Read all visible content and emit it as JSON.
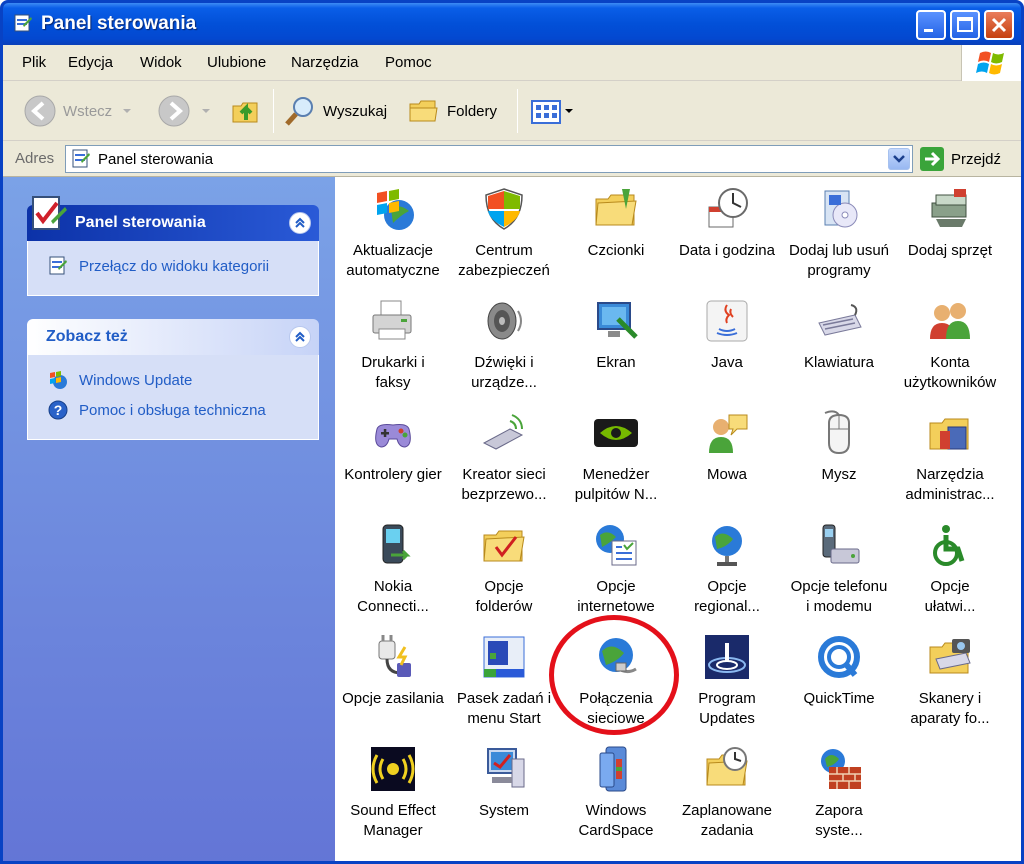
{
  "window": {
    "title": "Panel sterowania"
  },
  "menubar": {
    "items": [
      "Plik",
      "Edycja",
      "Widok",
      "Ulubione",
      "Narzędzia",
      "Pomoc"
    ]
  },
  "toolbar": {
    "back_label": "Wstecz",
    "search_label": "Wyszukaj",
    "folders_label": "Foldery"
  },
  "addressbar": {
    "label": "Adres",
    "value": "Panel sterowania",
    "go_label": "Przejdź"
  },
  "sidebar": {
    "panel_title": "Panel sterowania",
    "panel_link": "Przełącz do widoku kategorii",
    "see_also_title": "Zobacz też",
    "see_also_links": [
      "Windows Update",
      "Pomoc i obsługa techniczna"
    ]
  },
  "items": [
    {
      "label": "Aktualizacje\nautomatyczne",
      "icon": "windows-update-icon"
    },
    {
      "label": "Centrum\nzabezpieczeń",
      "icon": "security-shield-icon"
    },
    {
      "label": "Czcionki",
      "icon": "fonts-folder-icon"
    },
    {
      "label": "Data i godzina",
      "icon": "date-time-icon"
    },
    {
      "label": "Dodaj lub usuń\nprogramy",
      "icon": "add-remove-programs-icon"
    },
    {
      "label": "Dodaj sprzęt",
      "icon": "add-hardware-icon"
    },
    {
      "label": "Drukarki i\nfaksy",
      "icon": "printer-icon"
    },
    {
      "label": "Dźwięki i\nurządze...",
      "icon": "speaker-icon"
    },
    {
      "label": "Ekran",
      "icon": "display-icon"
    },
    {
      "label": "Java",
      "icon": "java-icon"
    },
    {
      "label": "Klawiatura",
      "icon": "keyboard-icon"
    },
    {
      "label": "Konta\nużytkowników",
      "icon": "user-accounts-icon"
    },
    {
      "label": "Kontrolery gier",
      "icon": "gamepad-icon"
    },
    {
      "label": "Kreator sieci\nbezprzewo...",
      "icon": "wireless-network-icon"
    },
    {
      "label": "Menedżer\npulpitów N...",
      "icon": "nvidia-icon"
    },
    {
      "label": "Mowa",
      "icon": "speech-icon"
    },
    {
      "label": "Mysz",
      "icon": "mouse-icon"
    },
    {
      "label": "Narzędzia\nadministrac...",
      "icon": "admin-tools-icon"
    },
    {
      "label": "Nokia\nConnecti...",
      "icon": "nokia-phone-icon"
    },
    {
      "label": "Opcje\nfolderów",
      "icon": "folder-options-icon"
    },
    {
      "label": "Opcje\ninternetowe",
      "icon": "internet-options-icon"
    },
    {
      "label": "Opcje\nregional...",
      "icon": "globe-icon"
    },
    {
      "label": "Opcje telefonu\ni modemu",
      "icon": "phone-modem-icon"
    },
    {
      "label": "Opcje\nułatwi...",
      "icon": "accessibility-icon"
    },
    {
      "label": "Opcje zasilania",
      "icon": "power-plug-icon"
    },
    {
      "label": "Pasek zadań i\nmenu Start",
      "icon": "taskbar-icon"
    },
    {
      "label": "Połączenia\nsieciowe",
      "icon": "network-connections-icon"
    },
    {
      "label": "Program\nUpdates",
      "icon": "program-updates-icon"
    },
    {
      "label": "QuickTime",
      "icon": "quicktime-icon"
    },
    {
      "label": "Skanery i\naparaty fo...",
      "icon": "scanner-camera-icon"
    },
    {
      "label": "Sound Effect\nManager",
      "icon": "sound-effect-icon"
    },
    {
      "label": "System",
      "icon": "system-computer-icon"
    },
    {
      "label": "Windows\nCardSpace",
      "icon": "cardspace-icon"
    },
    {
      "label": "Zaplanowane\nzadania",
      "icon": "scheduled-tasks-icon"
    },
    {
      "label": "Zapora\nsyste...",
      "icon": "firewall-icon"
    }
  ],
  "highlighted_item": "Połączenia\nsieciowe",
  "colors": {
    "title_bar": "#0250d8",
    "sidebar_bg": "#7ba2e7",
    "link_blue": "#215dc6",
    "highlight_red": "#e4101a"
  }
}
